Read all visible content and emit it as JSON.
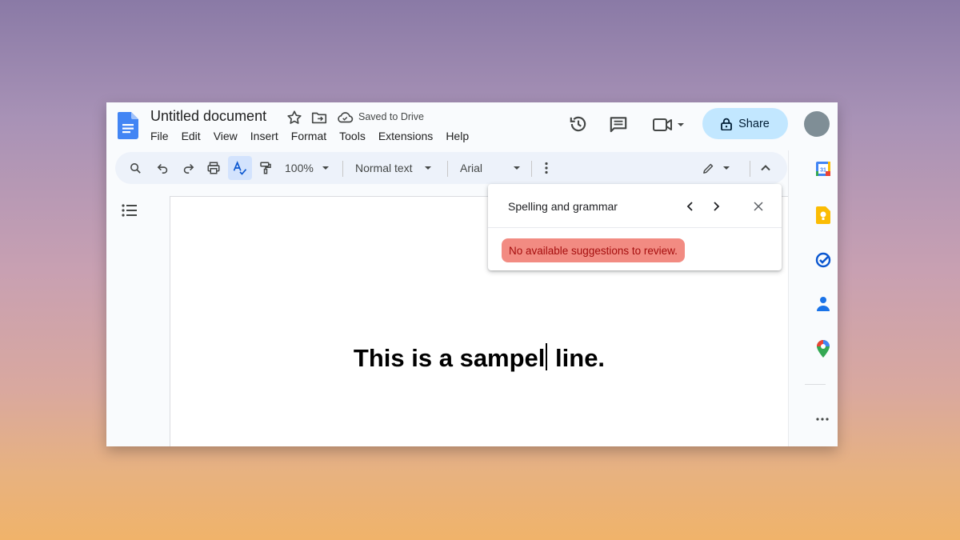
{
  "header": {
    "doc_title": "Untitled document",
    "saved_status": "Saved to Drive",
    "share_label": "Share"
  },
  "menu": [
    "File",
    "Edit",
    "View",
    "Insert",
    "Format",
    "Tools",
    "Extensions",
    "Help"
  ],
  "toolbar": {
    "zoom": "100%",
    "style": "Normal text",
    "font": "Arial"
  },
  "document": {
    "text_before_cursor": "This is a sampel",
    "text_after_cursor": " line."
  },
  "spell_panel": {
    "title": "Spelling and grammar",
    "message": "No available suggestions to review."
  },
  "icons": [
    "docs-logo-icon",
    "star-icon",
    "move-folder-icon",
    "cloud-saved-icon",
    "history-icon",
    "comments-icon",
    "meet-icon",
    "lock-icon",
    "search-icon",
    "undo-icon",
    "redo-icon",
    "print-icon",
    "spellcheck-icon",
    "paint-format-icon",
    "more-vert-icon",
    "pencil-icon",
    "collapse-icon",
    "outline-icon",
    "calendar-icon",
    "keep-icon",
    "tasks-icon",
    "contacts-icon",
    "maps-icon",
    "more-horiz-icon"
  ],
  "colors": {
    "share_bg": "#c2e7ff",
    "toolbar_bg": "#edf2fa",
    "alert_bg": "#f28b82",
    "alert_text": "#a50e0e",
    "docs_blue": "#4285f4"
  }
}
